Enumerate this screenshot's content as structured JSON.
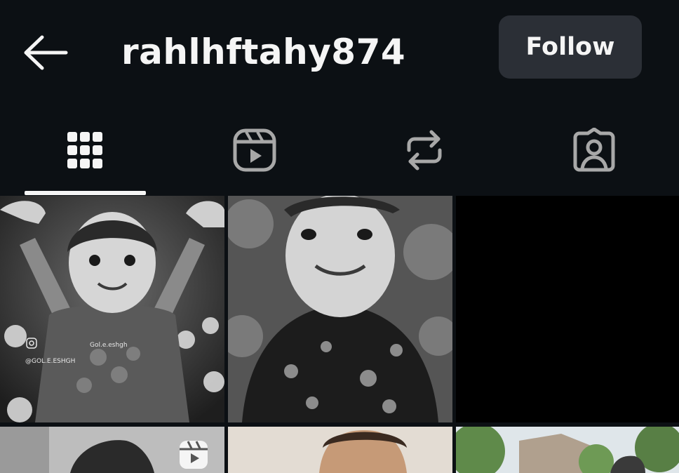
{
  "header": {
    "username": "rahlhftahy874",
    "follow_label": "Follow"
  },
  "tabs": [
    {
      "icon": "grid-icon",
      "active": true
    },
    {
      "icon": "reels-icon",
      "active": false
    },
    {
      "icon": "reposts-icon",
      "active": false
    },
    {
      "icon": "tagged-icon",
      "active": false
    }
  ],
  "posts": [
    {
      "watermark_handle": "@GOL.E.ESHGH",
      "watermark_brand": "Gol.e.eshgh"
    },
    {},
    {},
    {
      "type": "reel"
    },
    {},
    {}
  ],
  "colors": {
    "background": "#0c1014",
    "text": "#f5f5f5",
    "button": "#2b2f36",
    "inactive_icon": "#a8a8a8"
  }
}
